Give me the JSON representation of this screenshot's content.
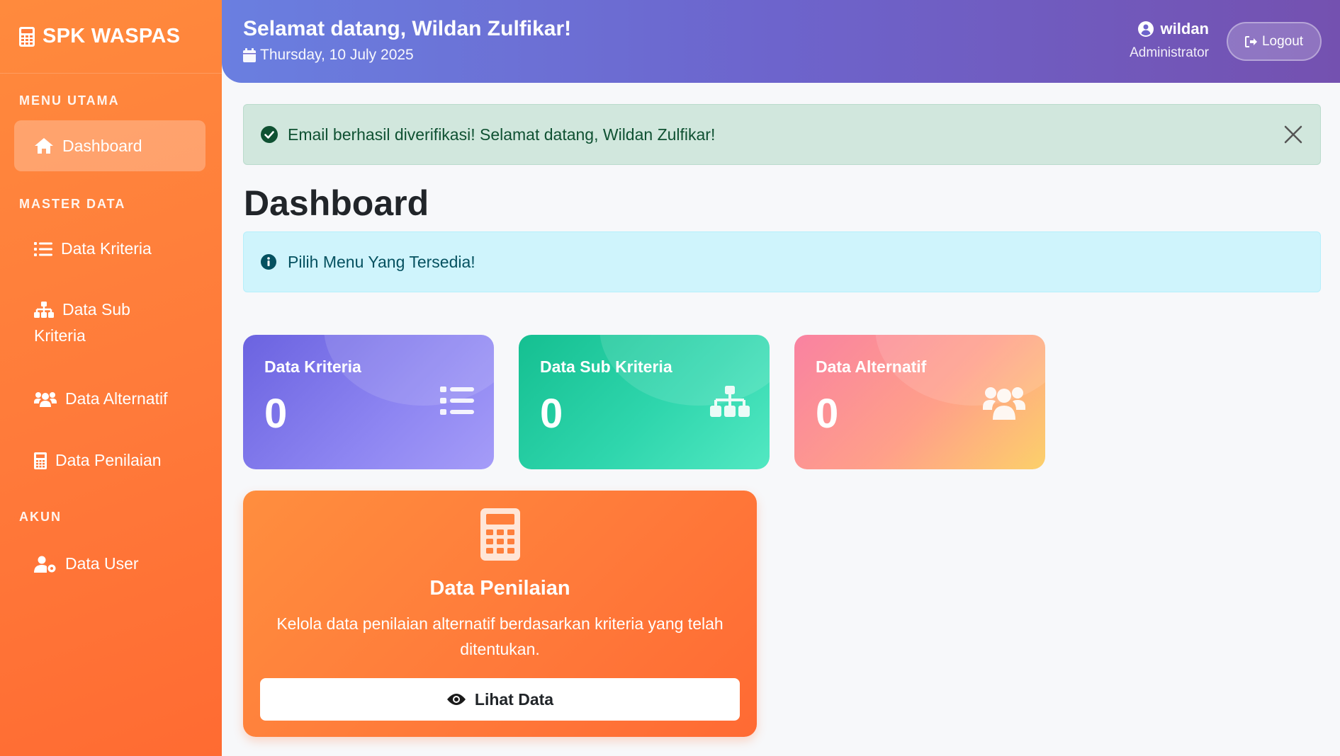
{
  "brand": {
    "name": "SPK WASPAS",
    "icon": "calculator-icon"
  },
  "sidebar": {
    "sections": [
      {
        "title": "MENU UTAMA"
      },
      {
        "title": "MASTER DATA"
      },
      {
        "title": "AKUN"
      }
    ],
    "items": [
      {
        "label": "Dashboard",
        "icon": "home-icon",
        "active": true
      },
      {
        "label": "Data Kriteria",
        "icon": "list-icon"
      },
      {
        "label_line1": "Data Sub",
        "label_line2": "Kriteria",
        "icon": "sitemap-icon"
      },
      {
        "label": "Data Alternatif",
        "icon": "users-icon"
      },
      {
        "label": "Data Penilaian",
        "icon": "calculator-icon"
      },
      {
        "label": "Data User",
        "icon": "user-gear-icon"
      }
    ]
  },
  "header": {
    "welcome": "Selamat datang, Wildan Zulfikar!",
    "date": "Thursday, 10 July 2025",
    "user_name": "wildan",
    "user_role": "Administrator",
    "logout_label": "Logout"
  },
  "alerts": {
    "success": "Email berhasil diverifikasi! Selamat datang, Wildan Zulfikar!",
    "info": "Pilih Menu Yang Tersedia!"
  },
  "page_title": "Dashboard",
  "stats": [
    {
      "label": "Data Kriteria",
      "value": "0",
      "icon": "list-icon",
      "color": "#7a72e8"
    },
    {
      "label": "Data Sub Kriteria",
      "value": "0",
      "icon": "sitemap-icon",
      "color": "#23cba0"
    },
    {
      "label": "Data Alternatif",
      "value": "0",
      "icon": "users-icon",
      "color": "#fd9a8a"
    }
  ],
  "penilaian": {
    "title": "Data Penilaian",
    "description": "Kelola data penilaian alternatif berdasarkan kriteria yang telah ditentukan.",
    "button_label": "Lihat Data"
  },
  "colors": {
    "sidebar": "#ff7a3a",
    "header_start": "#6a7fe0",
    "header_end": "#7451b0",
    "success_bg": "#d1e7dd",
    "info_bg": "#cff4fc"
  }
}
